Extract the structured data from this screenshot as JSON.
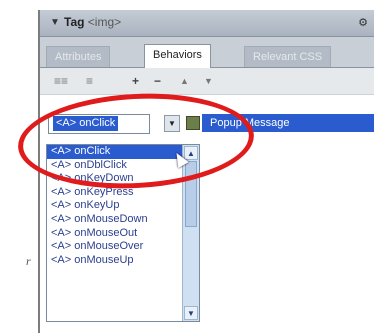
{
  "panel": {
    "arrow_glyph": "▼",
    "title": "Tag",
    "tag_name": "<img>",
    "menu_icon": "gear-icon"
  },
  "tabs": [
    {
      "label": "Attributes",
      "active": false
    },
    {
      "label": "Behaviors",
      "active": true
    },
    {
      "label": "Relevant CSS",
      "active": false
    }
  ],
  "toolbar": {
    "show_set_label": "≡≡",
    "show_all_label": "≡",
    "add_label": "+",
    "remove_label": "−",
    "up_label": "▲",
    "down_label": "▼"
  },
  "behavior": {
    "event_value": "<A> onClick",
    "action_label": "Popup Message"
  },
  "event_options": [
    "<A> onClick",
    "<A> onDblClick",
    "<A> onKeyDown",
    "<A> onKeyPress",
    "<A> onKeyUp",
    "<A> onMouseDown",
    "<A> onMouseOut",
    "<A> onMouseOver",
    "<A> onMouseUp"
  ],
  "stray_text": "r",
  "colors": {
    "selection": "#2a5ccf",
    "highlight_circle": "#e01b1b"
  }
}
